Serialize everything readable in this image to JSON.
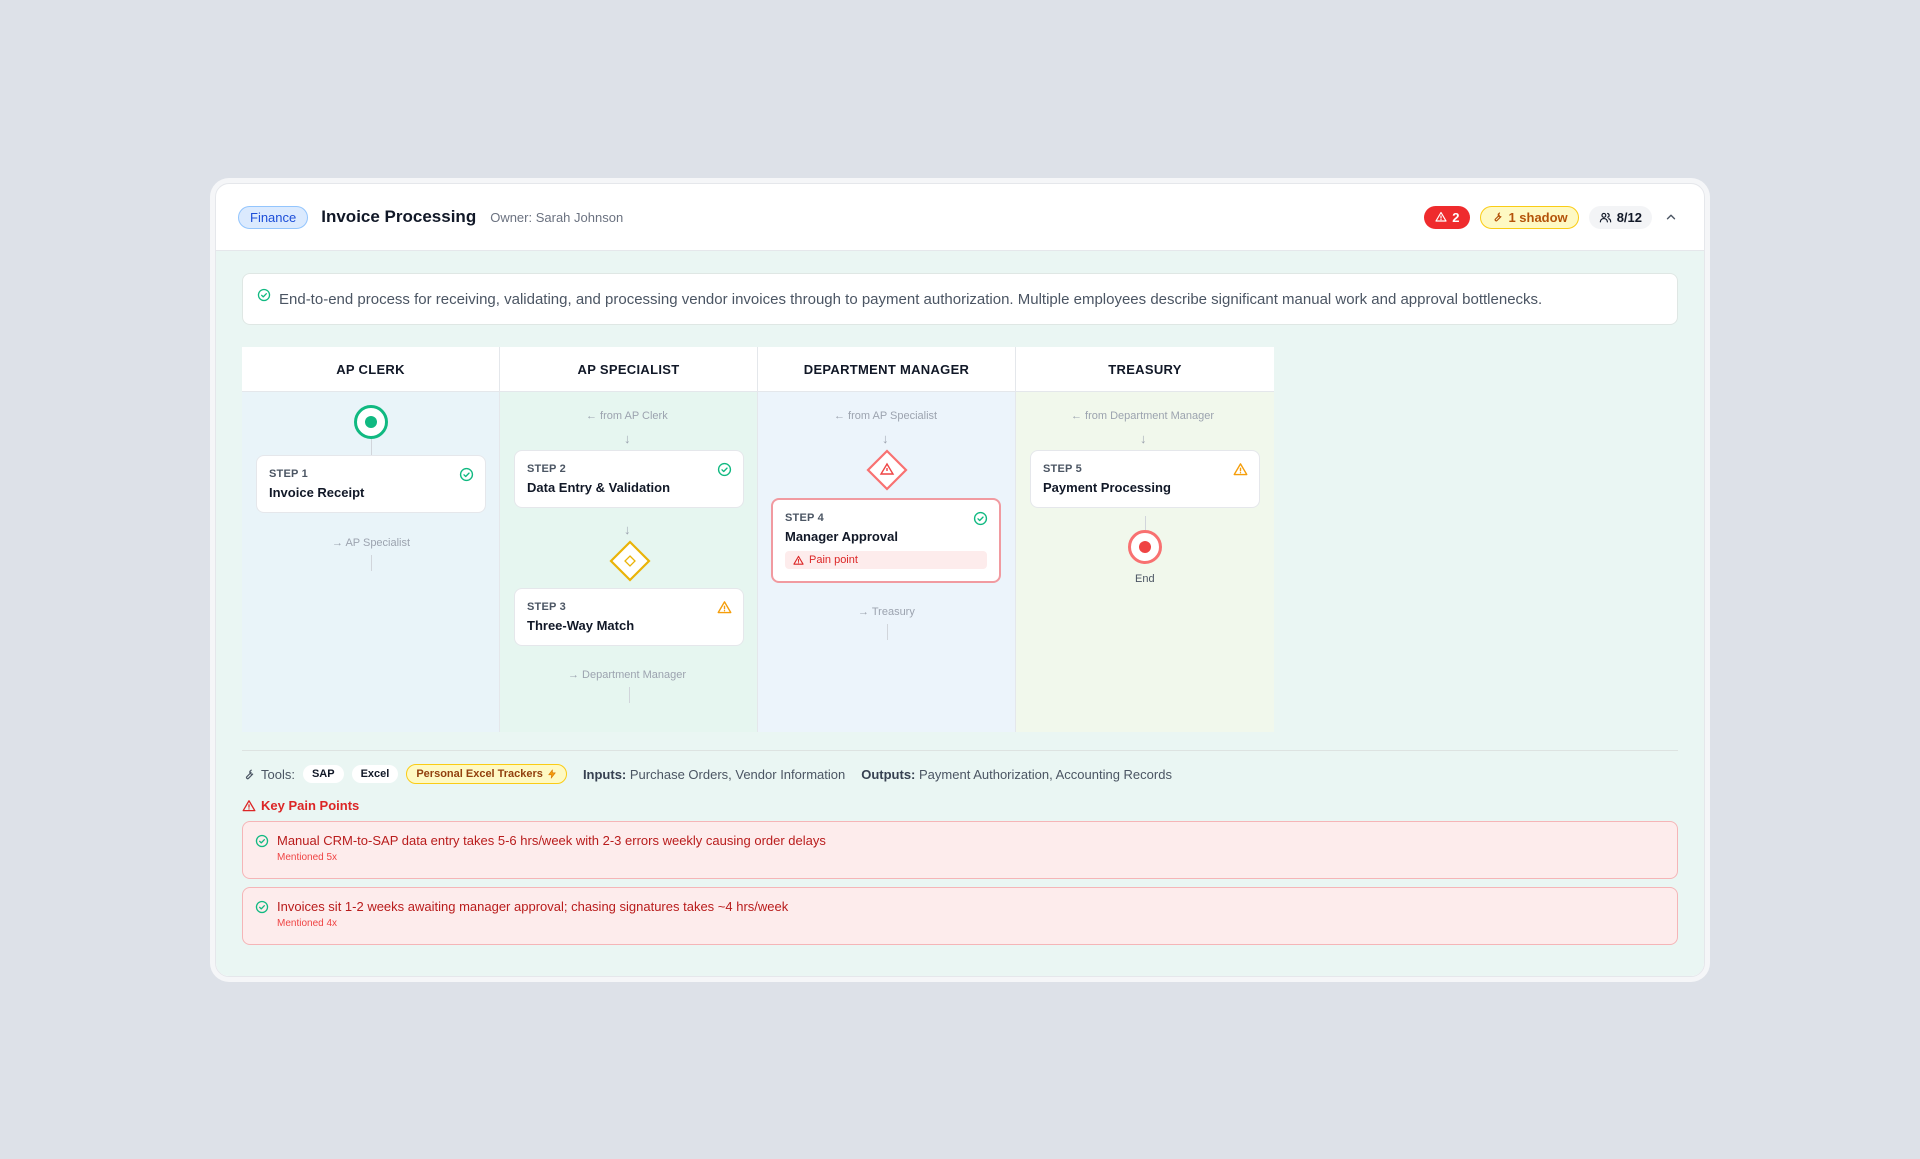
{
  "header": {
    "department": "Finance",
    "title": "Invoice Processing",
    "owner": "Owner: Sarah Johnson",
    "alerts_count": "2",
    "shadow_label": "1 shadow",
    "coverage": "8/12"
  },
  "description": "End-to-end process for receiving, validating, and processing vendor invoices through to payment authorization. Multiple employees describe significant manual work and approval bottlenecks.",
  "lanes": [
    {
      "name": "AP CLERK"
    },
    {
      "name": "AP SPECIALIST"
    },
    {
      "name": "DEPARTMENT MANAGER"
    },
    {
      "name": "TREASURY"
    }
  ],
  "flow": {
    "ap_clerk": {
      "to_label": "→ AP Specialist"
    },
    "ap_specialist": {
      "from_label": "← from AP Clerk",
      "to_label": "→ Department Manager"
    },
    "dept_manager": {
      "from_label": "← from AP Specialist",
      "to_label": "→ Treasury"
    },
    "treasury": {
      "from_label": "← from Department Manager",
      "end_label": "End"
    }
  },
  "steps": [
    {
      "num": "STEP 1",
      "name": "Invoice Receipt",
      "status": "validated"
    },
    {
      "num": "STEP 2",
      "name": "Data Entry & Validation",
      "status": "validated"
    },
    {
      "num": "STEP 3",
      "name": "Three-Way Match",
      "status": "warning"
    },
    {
      "num": "STEP 4",
      "name": "Manager Approval",
      "status": "validated",
      "pain_label": "Pain point"
    },
    {
      "num": "STEP 5",
      "name": "Payment Processing",
      "status": "warning"
    }
  ],
  "meta": {
    "tools_label": "Tools:",
    "tools": [
      "SAP",
      "Excel"
    ],
    "shadow_tool": "Personal Excel Trackers",
    "inputs_label": "Inputs:",
    "inputs": "Purchase Orders, Vendor Information",
    "outputs_label": "Outputs:",
    "outputs": "Payment Authorization, Accounting Records"
  },
  "pain_points": {
    "title": "Key Pain Points",
    "items": [
      {
        "text": "Manual CRM-to-SAP data entry takes 5-6 hrs/week with 2-3 errors weekly causing order delays",
        "mentions": "Mentioned 5x"
      },
      {
        "text": "Invoices sit 1-2 weeks awaiting manager approval; chasing signatures takes ~4 hrs/week",
        "mentions": "Mentioned 4x"
      }
    ]
  },
  "colors": {
    "validated": "#10b981",
    "warning": "#f59e0b",
    "danger": "#ef4444",
    "accent_blue": "#1d4ed8"
  },
  "icons": {
    "alert": "triangle-alert-icon",
    "shadow": "wrench-icon",
    "people": "users-icon",
    "collapse": "chevron-up-icon",
    "validated": "check-circle-icon",
    "warning": "warning-triangle-icon",
    "tools": "wrench-icon",
    "shadow_tool": "lightning-icon"
  }
}
